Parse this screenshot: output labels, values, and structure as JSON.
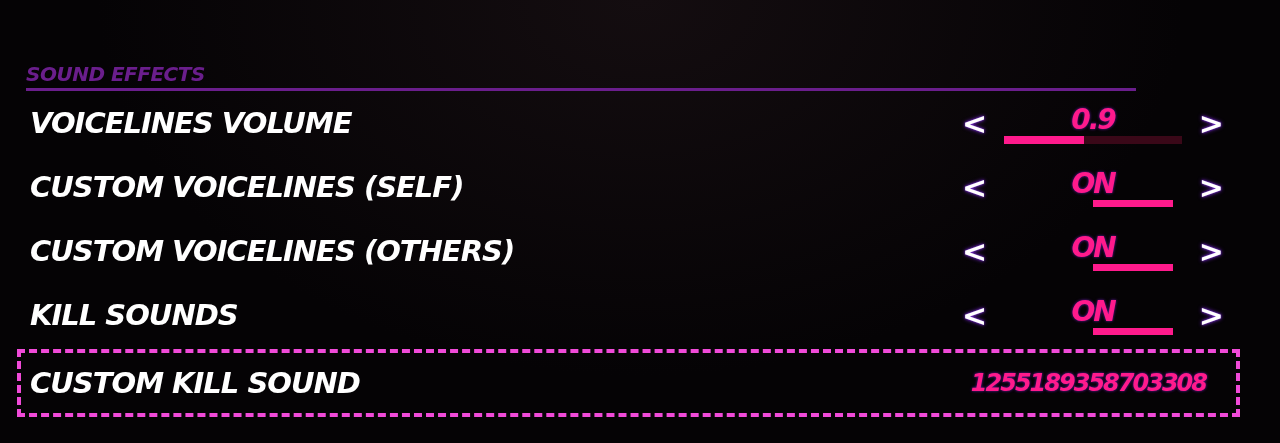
{
  "section": {
    "title": "SOUND EFFECTS"
  },
  "settings": [
    {
      "kind": "slider",
      "label": "VOICELINES VOLUME",
      "prev": "<",
      "value": "0.9",
      "next": ">",
      "level": 0.45,
      "selected": false
    },
    {
      "kind": "toggle",
      "label": "CUSTOM VOICELINES (SELF)",
      "prev": "<",
      "value": "ON",
      "next": ">",
      "on": true,
      "selected": false
    },
    {
      "kind": "toggle",
      "label": "CUSTOM VOICELINES (OTHERS)",
      "prev": "<",
      "value": "ON",
      "next": ">",
      "on": true,
      "selected": false
    },
    {
      "kind": "toggle",
      "label": "KILL SOUNDS",
      "prev": "<",
      "value": "ON",
      "next": ">",
      "on": true,
      "selected": false
    },
    {
      "kind": "text",
      "label": "CUSTOM KILL SOUND",
      "value": "1255189358703308",
      "selected": true
    }
  ]
}
